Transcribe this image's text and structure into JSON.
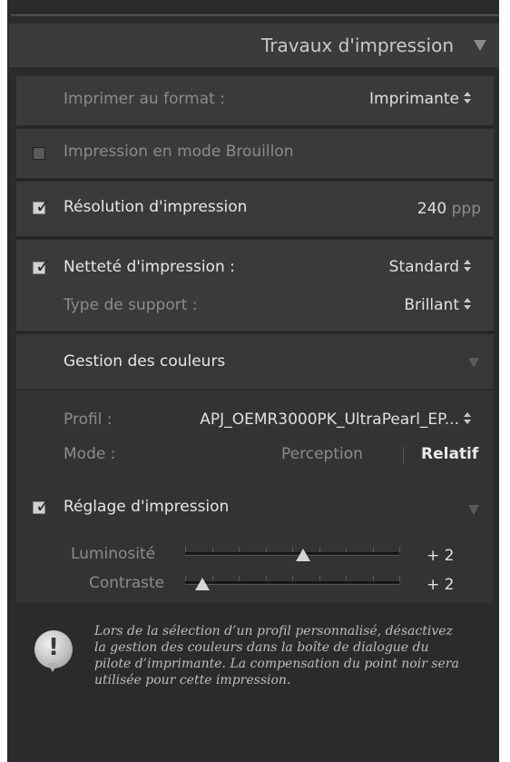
{
  "header": {
    "title": "Travaux d'impression",
    "collapse_icon": "triangle-down-icon"
  },
  "format": {
    "label": "Imprimer au format :",
    "value": "Imprimante"
  },
  "draft": {
    "label": "Impression en mode Brouillon",
    "checked": false
  },
  "resolution": {
    "label": "Résolution d'impression",
    "checked": true,
    "value": "240",
    "unit": "ppp"
  },
  "sharpening": {
    "label": "Netteté d'impression :",
    "checked": true,
    "value": "Standard",
    "media_label": "Type de support :",
    "media_value": "Brillant"
  },
  "color_management": {
    "title": "Gestion des couleurs",
    "profile_label": "Profil :",
    "profile_value": "APJ_OEMR3000PK_UltraPearl_EP...",
    "mode_label": "Mode :",
    "mode_perception": "Perception",
    "mode_relative": "Relatif"
  },
  "print_adjust": {
    "label": "Réglage d'impression",
    "checked": true,
    "brightness_label": "Luminosité",
    "brightness_value": "+ 2",
    "brightness_level": 0.55,
    "contrast_label": "Contraste",
    "contrast_value": "+ 2",
    "contrast_level": 0.08
  },
  "note": {
    "icon": "exclamation-icon",
    "text": "Lors de la sélection d’un profil personnalisé, désactivez la gestion des couleurs dans la boîte de dialogue du pilote d’imprimante. La compensation du point noir sera utilisée pour cette impression."
  }
}
